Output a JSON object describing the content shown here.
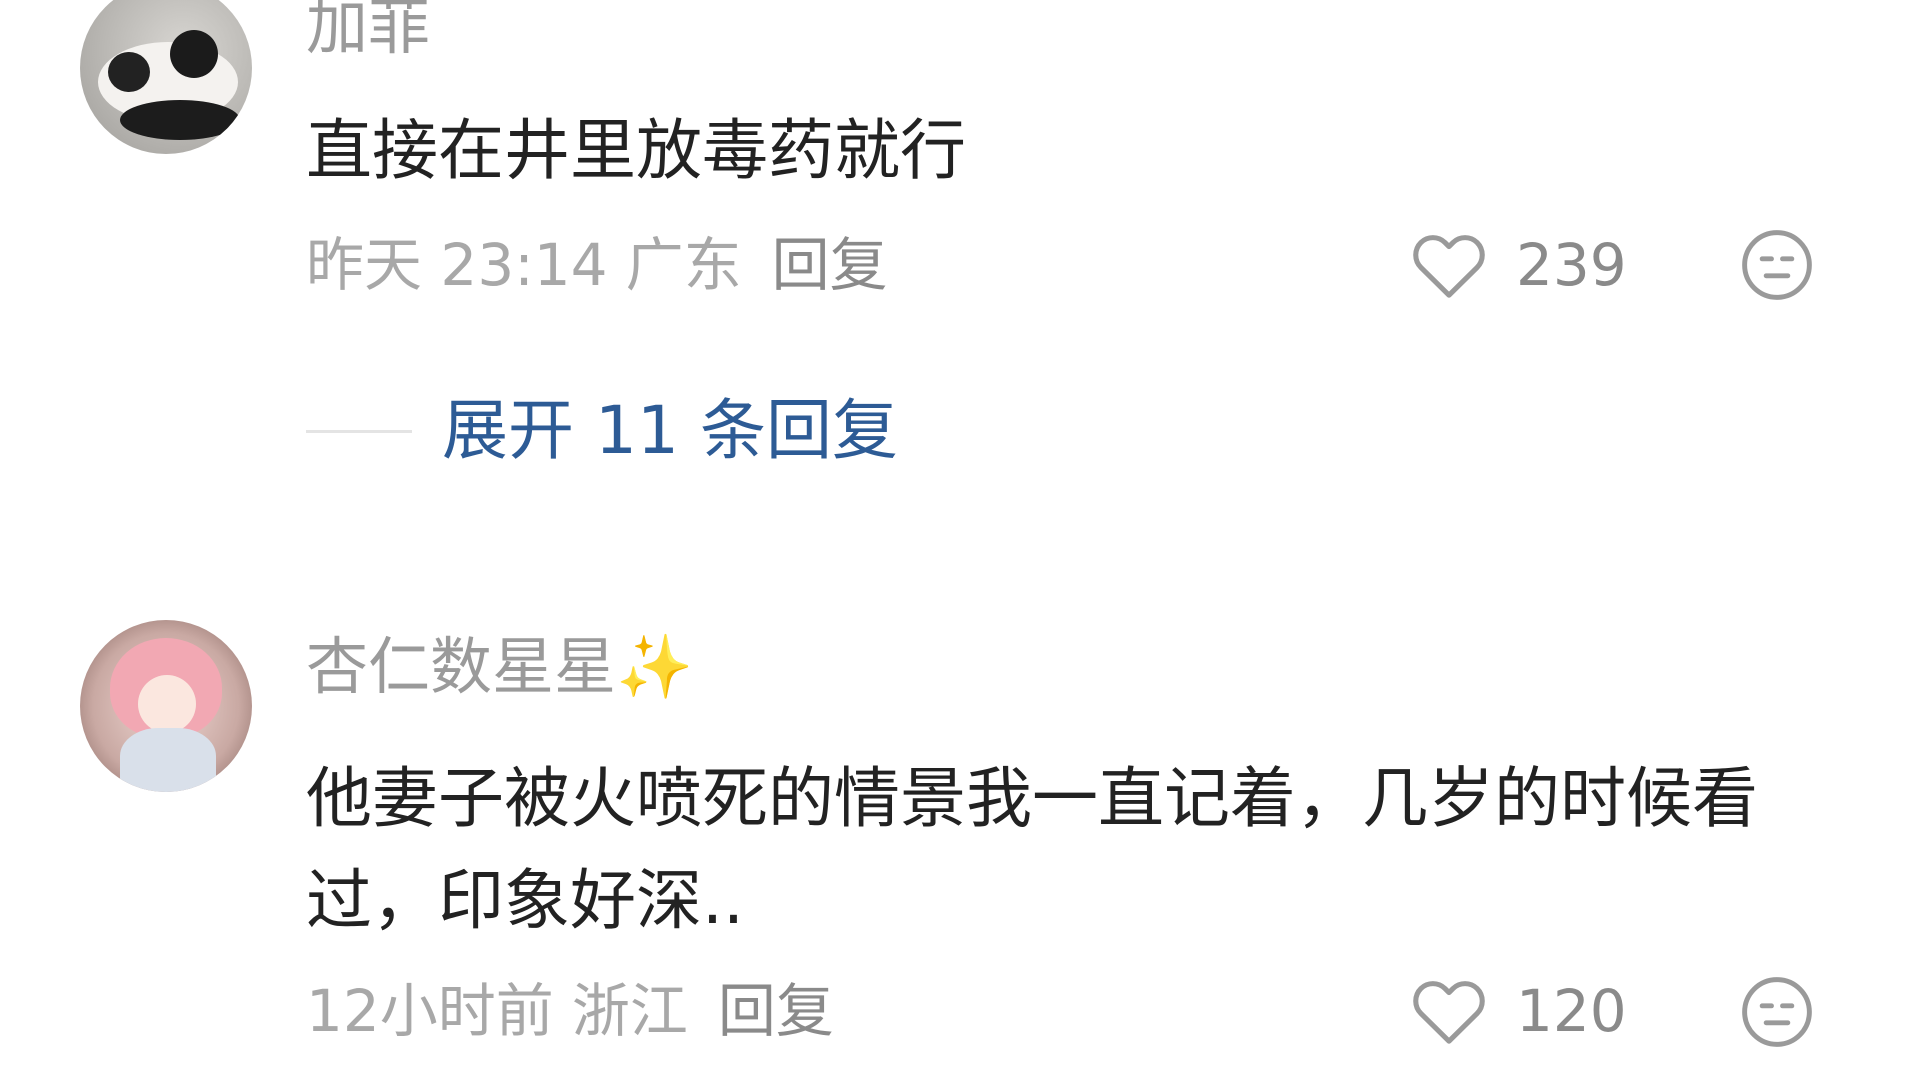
{
  "comments": [
    {
      "username": "加菲",
      "content": "直接在井里放毒药就行",
      "time": "昨天 23:14",
      "region": "广东",
      "reply_label": "回复",
      "likes": "239",
      "avatar": "panda-avatar",
      "expand_label": "展开 11 条回复"
    },
    {
      "username": "杏仁数星星",
      "username_emoji": "✨",
      "content": "他妻子被火喷死的情景我一直记着，几岁的时候看过，印象好深..",
      "time": "12小时前",
      "region": "浙江",
      "reply_label": "回复",
      "likes": "120",
      "avatar": "doll-avatar"
    }
  ],
  "icons": {
    "like": "heart-outline-icon",
    "emoji": "neutral-face-icon"
  },
  "colors": {
    "background": "#ffffff",
    "username": "#9a9a9a",
    "content": "#222222",
    "meta": "#a8a8a8",
    "expand_link": "#2d5b95",
    "sparkle": "#f4c20d"
  }
}
